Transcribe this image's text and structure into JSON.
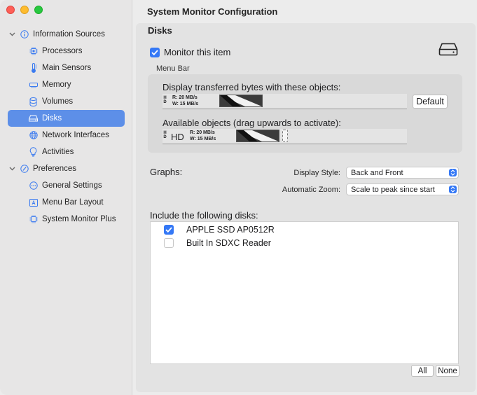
{
  "window": {
    "title": "System Monitor Configuration"
  },
  "sidebar": {
    "groups": [
      {
        "label": "Information Sources",
        "items": [
          {
            "label": "Processors",
            "icon": "cpu-icon"
          },
          {
            "label": "Main Sensors",
            "icon": "thermometer-icon"
          },
          {
            "label": "Memory",
            "icon": "memory-icon"
          },
          {
            "label": "Volumes",
            "icon": "database-icon"
          },
          {
            "label": "Disks",
            "icon": "drive-icon",
            "selected": true
          },
          {
            "label": "Network Interfaces",
            "icon": "globe-icon"
          },
          {
            "label": "Activities",
            "icon": "lightbulb-icon"
          }
        ]
      },
      {
        "label": "Preferences",
        "items": [
          {
            "label": "General Settings",
            "icon": "ellipsis-circle-icon"
          },
          {
            "label": "Menu Bar Layout",
            "icon": "menubar-icon"
          },
          {
            "label": "System Monitor Plus",
            "icon": "chip-icon"
          }
        ]
      }
    ]
  },
  "main": {
    "section_title": "Disks",
    "monitor_item": {
      "label": "Monitor this item",
      "checked": true
    },
    "menu_bar": {
      "label": "Menu Bar",
      "display_label": "Display transferred bytes with these objects:",
      "available_label": "Available objects (drag upwards to activate):",
      "hd_small": "H\nD",
      "hd_big": "HD",
      "read_text": "R: 20 MB/s",
      "write_text": "W: 15 MB/s",
      "default_button": "Default"
    },
    "graphs": {
      "label": "Graphs:",
      "display_style_label": "Display Style:",
      "display_style_value": "Back and Front",
      "zoom_label": "Automatic Zoom:",
      "zoom_value": "Scale to peak since start"
    },
    "disks": {
      "label": "Include the following disks:",
      "items": [
        {
          "name": "APPLE SSD AP0512R",
          "checked": true
        },
        {
          "name": "Built In SDXC Reader",
          "checked": false
        }
      ],
      "all_button": "All",
      "none_button": "None"
    }
  },
  "colors": {
    "accent": "#3478f6",
    "selection": "#5d8fe8"
  }
}
